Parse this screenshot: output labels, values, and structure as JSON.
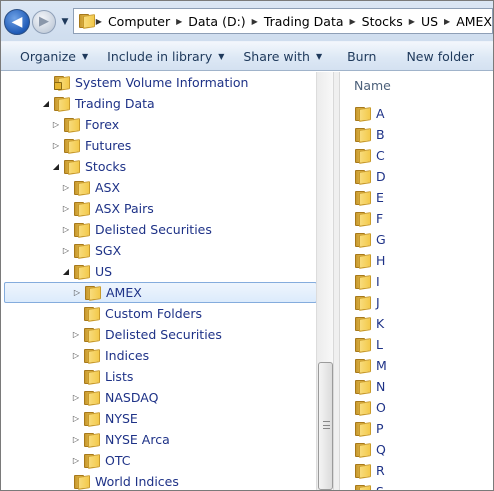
{
  "address": {
    "crumbs": [
      "Computer",
      "Data (D:)",
      "Trading Data",
      "Stocks",
      "US",
      "AMEX"
    ]
  },
  "toolbar": {
    "organize": "Organize",
    "include_in_library": "Include in library",
    "share_with": "Share with",
    "burn": "Burn",
    "new_folder": "New folder"
  },
  "tree": {
    "items": [
      {
        "label": "System Volume Information",
        "expander": "none",
        "icon": "locked-folder-icon"
      },
      {
        "label": "Trading Data",
        "expander": "open",
        "icon": "folder-icon"
      },
      {
        "label": "Forex",
        "expander": "closed",
        "icon": "folder-icon"
      },
      {
        "label": "Futures",
        "expander": "closed",
        "icon": "folder-icon"
      },
      {
        "label": "Stocks",
        "expander": "open",
        "icon": "folder-icon"
      },
      {
        "label": "ASX",
        "expander": "closed",
        "icon": "folder-icon"
      },
      {
        "label": "ASX Pairs",
        "expander": "closed",
        "icon": "folder-icon"
      },
      {
        "label": "Delisted Securities",
        "expander": "closed",
        "icon": "folder-icon"
      },
      {
        "label": "SGX",
        "expander": "closed",
        "icon": "folder-icon"
      },
      {
        "label": "US",
        "expander": "open",
        "icon": "folder-icon"
      },
      {
        "label": "AMEX",
        "expander": "closed",
        "icon": "folder-icon",
        "selected": true
      },
      {
        "label": "Custom Folders",
        "expander": "none",
        "icon": "folder-icon"
      },
      {
        "label": "Delisted Securities",
        "expander": "closed",
        "icon": "folder-icon"
      },
      {
        "label": "Indices",
        "expander": "closed",
        "icon": "folder-icon"
      },
      {
        "label": "Lists",
        "expander": "none",
        "icon": "folder-icon"
      },
      {
        "label": "NASDAQ",
        "expander": "closed",
        "icon": "folder-icon"
      },
      {
        "label": "NYSE",
        "expander": "closed",
        "icon": "folder-icon"
      },
      {
        "label": "NYSE Arca",
        "expander": "closed",
        "icon": "folder-icon"
      },
      {
        "label": "OTC",
        "expander": "closed",
        "icon": "folder-icon"
      },
      {
        "label": "World Indices",
        "expander": "none",
        "icon": "folder-icon"
      }
    ]
  },
  "list": {
    "column_name": "Name",
    "items": [
      "A",
      "B",
      "C",
      "D",
      "E",
      "F",
      "G",
      "H",
      "I",
      "J",
      "K",
      "L",
      "M",
      "N",
      "O",
      "P",
      "Q",
      "R",
      "S"
    ]
  }
}
